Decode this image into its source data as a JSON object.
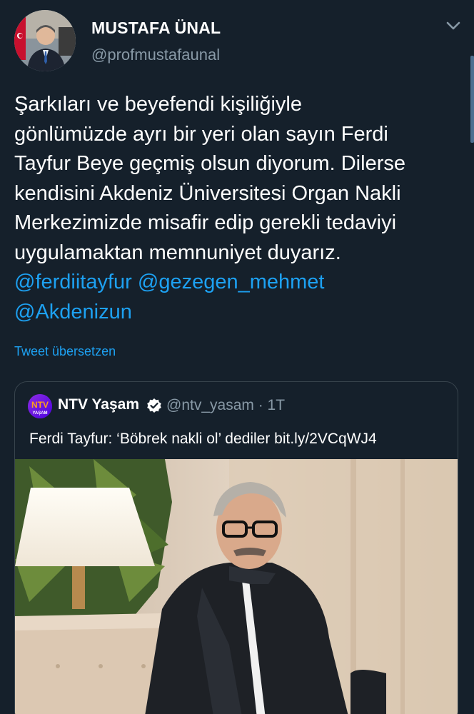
{
  "author": {
    "display_name": "MUSTAFA ÜNAL",
    "handle": "@profmustafaunal"
  },
  "tweet": {
    "lines": [
      "Şarkıları ve beyefendi kişiliğiyle",
      "gönlümüzde ayrı bir yeri olan sayın Ferdi",
      "Tayfur Beye geçmiş olsun diyorum. Dilerse",
      "kendisini Akdeniz Üniversitesi Organ Nakli",
      "Merkezimizde misafir edip gerekli tedaviyi",
      "uygulamaktan memnuniyet duyarız."
    ],
    "mentions": [
      "@ferdiitayfur",
      "@gezegen_mehmet",
      "@Akdenizun"
    ],
    "translate_label": "Tweet übersetzen"
  },
  "quoted_tweet": {
    "display_name": "NTV Yaşam",
    "handle_time": "@ntv_yasam · 1T",
    "text": "Ferdi Tayfur: ‘Böbrek nakli ol’ dediler bit.ly/2VCqWJ4",
    "avatar_logo": "NTV",
    "avatar_sub": "YAŞAM"
  },
  "icons": {
    "chevron": "chevron-down-icon",
    "verified": "verified-badge-icon"
  },
  "colors": {
    "background": "#15202b",
    "text": "#ffffff",
    "secondary": "#8899a6",
    "link": "#1da1f2",
    "border": "#38444d"
  }
}
